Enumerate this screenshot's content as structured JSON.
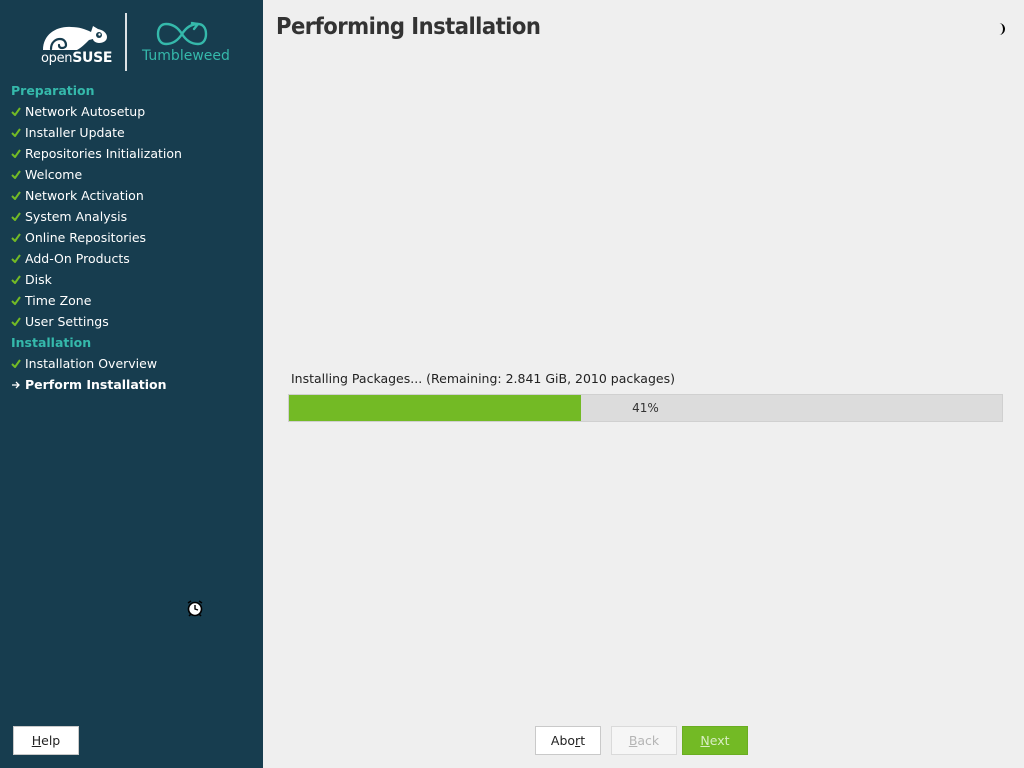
{
  "branding": {
    "distro_prefix": "open",
    "distro_name": "SUSE",
    "edition": "Tumbleweed",
    "accent_color": "#35b9ab",
    "sidebar_color": "#173d4f"
  },
  "sidebar": {
    "sections": [
      {
        "title": "Preparation",
        "steps": [
          {
            "label": "Network Autosetup",
            "state": "done"
          },
          {
            "label": "Installer Update",
            "state": "done"
          },
          {
            "label": "Repositories Initialization",
            "state": "done"
          },
          {
            "label": "Welcome",
            "state": "done"
          },
          {
            "label": "Network Activation",
            "state": "done"
          },
          {
            "label": "System Analysis",
            "state": "done"
          },
          {
            "label": "Online Repositories",
            "state": "done"
          },
          {
            "label": "Add-On Products",
            "state": "done"
          },
          {
            "label": "Disk",
            "state": "done"
          },
          {
            "label": "Time Zone",
            "state": "done"
          },
          {
            "label": "User Settings",
            "state": "done"
          }
        ]
      },
      {
        "title": "Installation",
        "steps": [
          {
            "label": "Installation Overview",
            "state": "done"
          },
          {
            "label": "Perform Installation",
            "state": "current"
          }
        ]
      }
    ],
    "icons": {
      "done": "check-icon",
      "current": "arrow-right-icon"
    }
  },
  "main": {
    "title": "Performing Installation",
    "theme_icon": "half-moon-icon",
    "progress": {
      "label": "Installing Packages... (Remaining: 2.841 GiB, 2010 packages)",
      "percent": 41,
      "text": "41%",
      "fill_color": "#73ba25"
    }
  },
  "buttons": {
    "help": {
      "label": "Help",
      "mnemonic": "H",
      "rest": "elp",
      "enabled": true
    },
    "abort": {
      "label": "Abort",
      "prefix": "Abo",
      "mnemonic": "r",
      "rest": "t",
      "enabled": true
    },
    "back": {
      "label": "Back",
      "mnemonic": "B",
      "rest": "ack",
      "enabled": false
    },
    "next": {
      "label": "Next",
      "mnemonic": "N",
      "rest": "ext",
      "enabled": false
    }
  }
}
